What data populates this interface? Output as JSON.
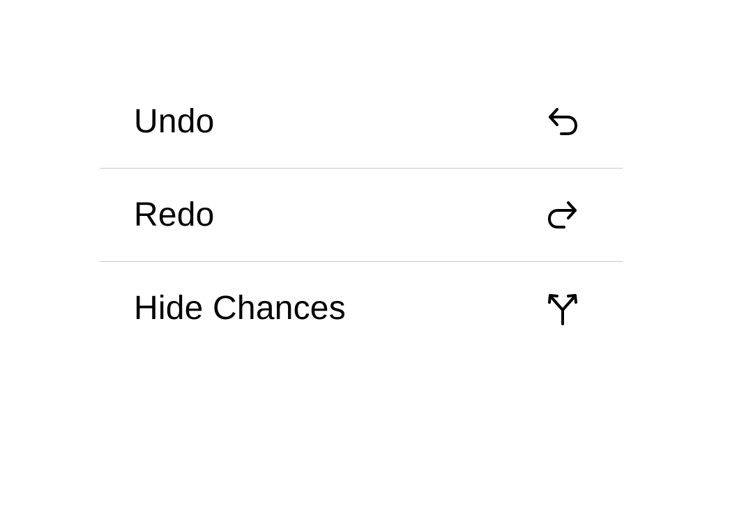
{
  "menu": {
    "items": [
      {
        "label": "Undo",
        "icon": "undo-arrow-icon"
      },
      {
        "label": "Redo",
        "icon": "redo-arrow-icon"
      },
      {
        "label": "Hide Chances",
        "icon": "branch-split-icon"
      }
    ]
  },
  "colors": {
    "text": "#000000",
    "divider": "#c9c9cc",
    "background": "#ffffff"
  }
}
